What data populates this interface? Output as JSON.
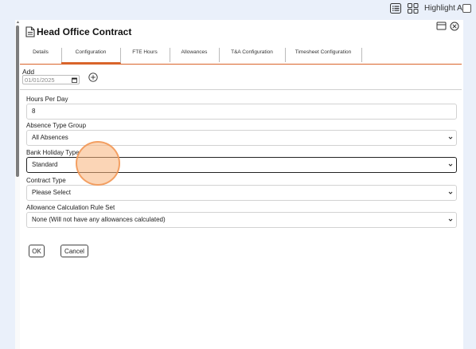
{
  "toolbar": {
    "list_view_icon": "list-view-icon",
    "grid_view_icon": "grid-view-icon",
    "highlight_all_label": "Highlight All"
  },
  "dialog": {
    "title": "Head Office Contract",
    "tabs": [
      {
        "label": "Details"
      },
      {
        "label": "Configuration",
        "active": true
      },
      {
        "label": "FTE Hours"
      },
      {
        "label": "Allowances"
      },
      {
        "label": "T&A Configuration"
      },
      {
        "label": "Timesheet Configuration"
      }
    ],
    "add_label": "Add",
    "add_date_value": "01/01/2025",
    "fields": {
      "hours_per_day": {
        "label": "Hours Per Day",
        "value": "8"
      },
      "absence_type_group": {
        "label": "Absence Type Group",
        "value": "All Absences"
      },
      "bank_holiday_type": {
        "label": "Bank Holiday Type",
        "value": "Standard"
      },
      "contract_type": {
        "label": "Contract Type",
        "value": "Please Select"
      },
      "allowance_rule_set": {
        "label": "Allowance Calculation Rule Set",
        "value": "None (Will not have any allowances calculated)"
      }
    },
    "ok_label": "OK",
    "cancel_label": "Cancel"
  },
  "colors": {
    "accent": "#d9642a",
    "background": "#eaf0fa",
    "click_marker": "#f7b27a"
  }
}
